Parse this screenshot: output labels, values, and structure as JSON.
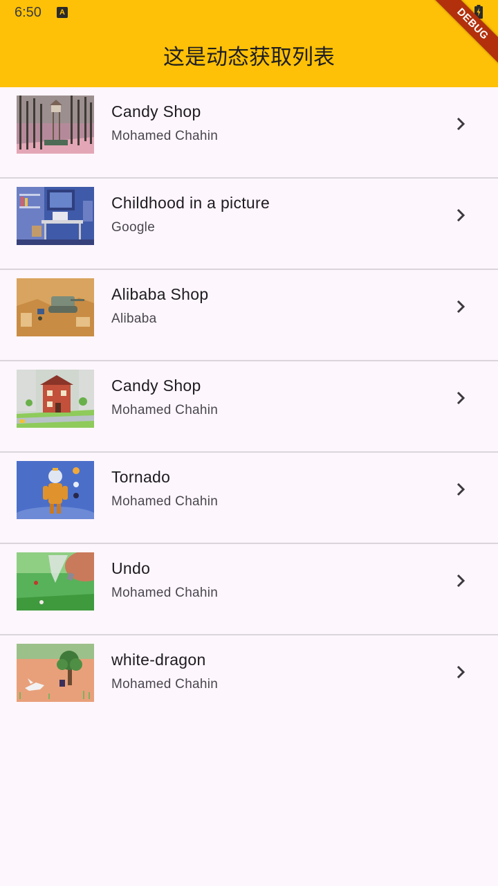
{
  "status_bar": {
    "time": "6:50",
    "a_glyph": "A"
  },
  "app_bar": {
    "title": "这是动态获取列表",
    "background_color": "#ffc107"
  },
  "debug_banner": {
    "label": "DEBUG"
  },
  "list": {
    "items": [
      {
        "title": "Candy Shop",
        "subtitle": "Mohamed Chahin",
        "thumbnail": "forest-watchtower-image"
      },
      {
        "title": "Childhood in a picture",
        "subtitle": "Google",
        "thumbnail": "desk-room-image"
      },
      {
        "title": "Alibaba Shop",
        "subtitle": "Alibaba",
        "thumbnail": "desert-tank-image"
      },
      {
        "title": "Candy Shop",
        "subtitle": "Mohamed Chahin",
        "thumbnail": "brick-house-image"
      },
      {
        "title": "Tornado",
        "subtitle": "Mohamed Chahin",
        "thumbnail": "robot-figure-image"
      },
      {
        "title": "Undo",
        "subtitle": "Mohamed Chahin",
        "thumbnail": "grass-tornado-image"
      },
      {
        "title": "white-dragon",
        "subtitle": "Mohamed Chahin",
        "thumbnail": "tree-dragon-image"
      }
    ]
  }
}
